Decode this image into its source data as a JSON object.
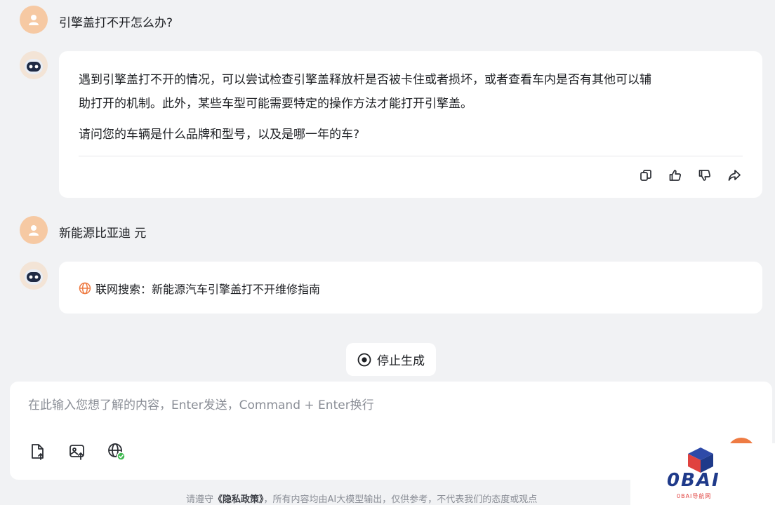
{
  "conversation": {
    "q1": "引擎盖打不开怎么办?",
    "a1_p1_line1": "遇到引擎盖打不开的情况，可以尝试检查引擎盖释放杆是否被卡住或者损坏，或者查看车内是否有其他可以辅",
    "a1_p1_line2": "助打开的机制。此外，某些车型可能需要特定的操作方法才能打开引擎盖。",
    "a1_p2": "请问您的车辆是什么品牌和型号，以及是哪一年的车?",
    "q2": "新能源比亚迪 元",
    "search_status": "联网搜索：新能源汽车引擎盖打不开维修指南"
  },
  "actions": [
    "copy-icon",
    "thumbs-up-icon",
    "thumbs-down-icon",
    "share-icon"
  ],
  "stop_button": {
    "label": "停止生成"
  },
  "input": {
    "placeholder": "在此输入您想了解的内容，Enter发送，Command + Enter换行",
    "value": ""
  },
  "toolbar": [
    "file-upload-icon",
    "image-upload-icon",
    "web-search-icon"
  ],
  "footer": {
    "prefix": "请遵守",
    "policy_link": "《隐私政策》",
    "suffix": "，所有内容均由AI大模型输出，仅供参考，不代表我们的态度或观点"
  },
  "watermark": {
    "brand": "0BAI",
    "subtitle": "0BAI导航网"
  },
  "colors": {
    "accent": "#ee7b43",
    "user_avatar": "#f6c9a3",
    "background": "#f1f2f4"
  }
}
